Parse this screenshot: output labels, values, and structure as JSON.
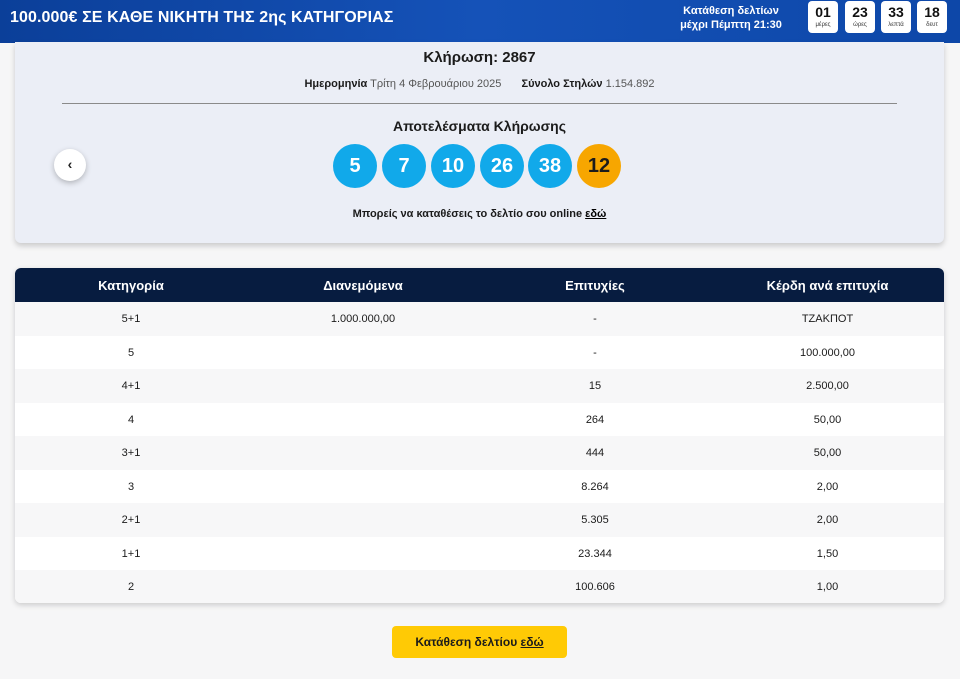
{
  "banner": {
    "promo": "100.000€ ΣΕ ΚΑΘΕ ΝΙΚΗΤΗ ΤΗΣ 2ης ΚΑΤΗΓΟΡΙΑΣ",
    "deadline_line1": "Κατάθεση δελτίων",
    "deadline_line2": "μέχρι Πέμπτη 21:30",
    "countdown": [
      {
        "value": "01",
        "unit": "μέρες"
      },
      {
        "value": "23",
        "unit": "ώρες"
      },
      {
        "value": "33",
        "unit": "λεπτά"
      },
      {
        "value": "18",
        "unit": "δευτ"
      }
    ]
  },
  "draw": {
    "title": "Κλήρωση: 2867",
    "date_label": "Ημερομηνία",
    "date_value": "Τρίτη 4 Φεβρουάριου 2025",
    "columns_label": "Σύνολο Στηλών",
    "columns_value": "1.154.892",
    "results_title": "Αποτελέσματα Κλήρωσης",
    "numbers": [
      "5",
      "7",
      "10",
      "26",
      "38"
    ],
    "joker": "12",
    "prev_icon": "‹",
    "online_text": "Μπορείς να καταθέσεις το δελτίο σου online",
    "online_link": "εδώ",
    "colors": {
      "ball": "#11a9ea",
      "joker": "#f7a600"
    }
  },
  "table": {
    "headers": [
      "Κατηγορία",
      "Διανεμόμενα",
      "Επιτυχίες",
      "Κέρδη ανά επιτυχία"
    ],
    "rows": [
      [
        "5+1",
        "1.000.000,00",
        "-",
        "ΤΖΑΚΠΟΤ"
      ],
      [
        "5",
        "",
        "-",
        "100.000,00"
      ],
      [
        "4+1",
        "",
        "15",
        "2.500,00"
      ],
      [
        "4",
        "",
        "264",
        "50,00"
      ],
      [
        "3+1",
        "",
        "444",
        "50,00"
      ],
      [
        "3",
        "",
        "8.264",
        "2,00"
      ],
      [
        "2+1",
        "",
        "5.305",
        "2,00"
      ],
      [
        "1+1",
        "",
        "23.344",
        "1,50"
      ],
      [
        "2",
        "",
        "100.606",
        "1,00"
      ]
    ],
    "colors": {
      "header": "#071c40"
    }
  },
  "cta": {
    "label": "Κατάθεση δελτίου",
    "link": "εδώ",
    "color": "#ffca05"
  }
}
